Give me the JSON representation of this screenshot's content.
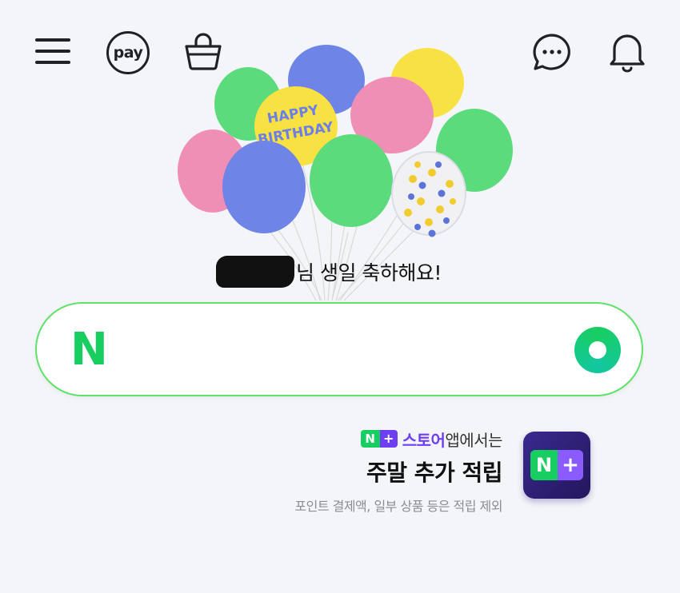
{
  "header": {
    "pay_label": "pay"
  },
  "greeting": {
    "text": "님 생일 축하해요!",
    "balloon_text_line1": "HAPPY",
    "balloon_text_line2": "BIRTHDAY"
  },
  "search": {
    "logo_letter": "N",
    "placeholder": ""
  },
  "promo": {
    "badge_n": "N",
    "badge_plus": "+",
    "store_label": "스토어",
    "line1_rest": "앱에서는",
    "title": "주말 추가 적립",
    "subtitle": "포인트 결제액, 일부 상품 등은 적립 제외",
    "app_icon_n": "N",
    "app_icon_plus": "+"
  },
  "colors": {
    "brand_green": "#19ce60",
    "plus_purple": "#6e3ef3",
    "background": "#f4f5f9"
  },
  "icons": [
    "menu-icon",
    "pay-icon",
    "shopping-bag-icon",
    "chat-icon",
    "bell-icon",
    "search-lens-icon"
  ]
}
